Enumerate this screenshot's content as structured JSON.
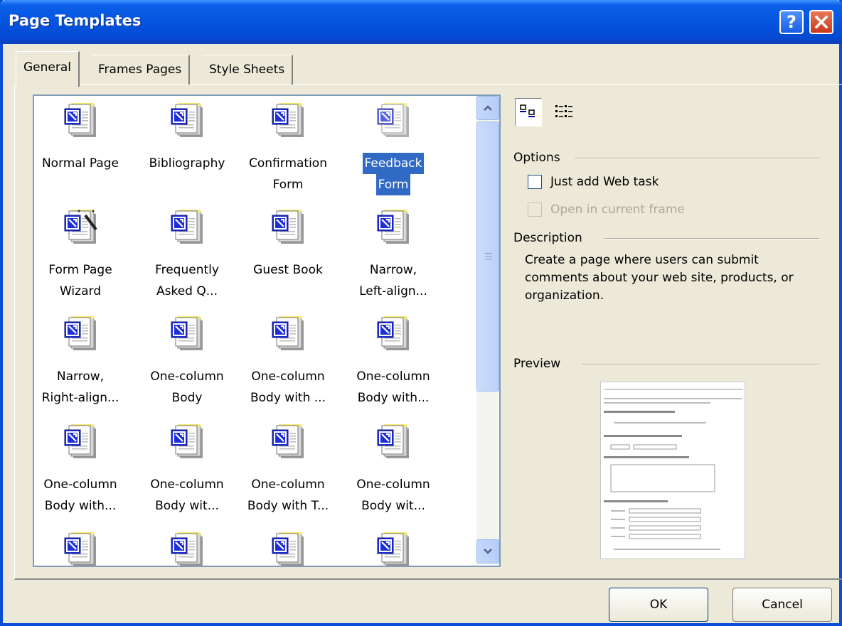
{
  "window": {
    "title": "Page Templates"
  },
  "tabs": [
    {
      "label": "General",
      "active": true
    },
    {
      "label": "Frames Pages",
      "active": false
    },
    {
      "label": "Style Sheets",
      "active": false
    }
  ],
  "templates": [
    {
      "line1": "Normal Page",
      "line2": "",
      "icon": "page-template-icon"
    },
    {
      "line1": "Bibliography",
      "line2": "",
      "icon": "page-template-icon"
    },
    {
      "line1": "Confirmation",
      "line2": "Form",
      "icon": "page-template-icon"
    },
    {
      "line1": "Feedback",
      "line2": "Form",
      "icon": "page-template-icon",
      "selected": true
    },
    {
      "line1": "Form Page",
      "line2": "Wizard",
      "icon": "wizard-icon"
    },
    {
      "line1": "Frequently",
      "line2": "Asked Q...",
      "icon": "page-template-icon"
    },
    {
      "line1": "Guest Book",
      "line2": "",
      "icon": "page-template-icon"
    },
    {
      "line1": "Narrow,",
      "line2": "Left-align...",
      "icon": "page-template-icon"
    },
    {
      "line1": "Narrow,",
      "line2": "Right-align...",
      "icon": "page-template-icon"
    },
    {
      "line1": "One-column",
      "line2": "Body",
      "icon": "page-template-icon"
    },
    {
      "line1": "One-column",
      "line2": "Body with ...",
      "icon": "page-template-icon"
    },
    {
      "line1": "One-column",
      "line2": "Body with...",
      "icon": "page-template-icon"
    },
    {
      "line1": "One-column",
      "line2": "Body with...",
      "icon": "page-template-icon"
    },
    {
      "line1": "One-column",
      "line2": "Body wit...",
      "icon": "page-template-icon"
    },
    {
      "line1": "One-column",
      "line2": "Body with T...",
      "icon": "page-template-icon"
    },
    {
      "line1": "One-column",
      "line2": "Body wit...",
      "icon": "page-template-icon"
    },
    {
      "line1": "",
      "line2": "",
      "icon": "page-template-icon"
    },
    {
      "line1": "",
      "line2": "",
      "icon": "page-template-icon"
    },
    {
      "line1": "",
      "line2": "",
      "icon": "page-template-icon"
    },
    {
      "line1": "",
      "line2": "",
      "icon": "page-template-icon"
    }
  ],
  "options": {
    "heading": "Options",
    "just_add_web_task": {
      "label": "Just add Web task",
      "checked": false,
      "enabled": true
    },
    "open_in_current_frame": {
      "label": "Open in current frame",
      "checked": false,
      "enabled": false
    }
  },
  "description": {
    "heading": "Description",
    "text": "Create a page where users can submit comments about your web site, products, or organization."
  },
  "preview": {
    "heading": "Preview"
  },
  "buttons": {
    "ok": "OK",
    "cancel": "Cancel"
  },
  "colors": {
    "titlebar": "#0555e0",
    "selection": "#316ac5",
    "dialog_bg": "#ece9d8"
  }
}
